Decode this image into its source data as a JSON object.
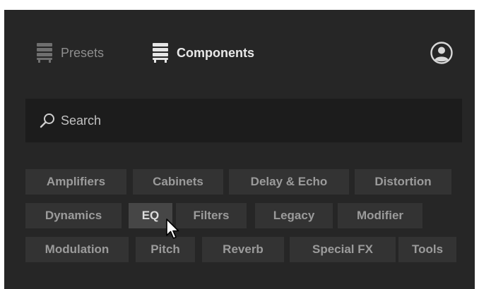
{
  "header": {
    "tabs": [
      {
        "label": "Presets",
        "icon": "presets-rack-icon",
        "active": false
      },
      {
        "label": "Components",
        "icon": "components-rack-icon",
        "active": true
      }
    ],
    "account_icon": "user-account-icon"
  },
  "search": {
    "placeholder": "Search",
    "value": ""
  },
  "categories": [
    "Amplifiers",
    "Cabinets",
    "Delay & Echo",
    "Distortion",
    "Dynamics",
    "EQ",
    "Filters",
    "Legacy",
    "Modifier",
    "Modulation",
    "Pitch",
    "Reverb",
    "Special FX",
    "Tools"
  ],
  "hovered_category": "EQ",
  "colors": {
    "panel_background": "#262626",
    "search_background": "#1c1c1c",
    "chip_background": "#333333",
    "chip_text": "#9b9b9b",
    "chip_hover_background": "#464646",
    "active_tab_text": "#e9e9e9",
    "inactive_tab_text": "#8e8e8e"
  }
}
